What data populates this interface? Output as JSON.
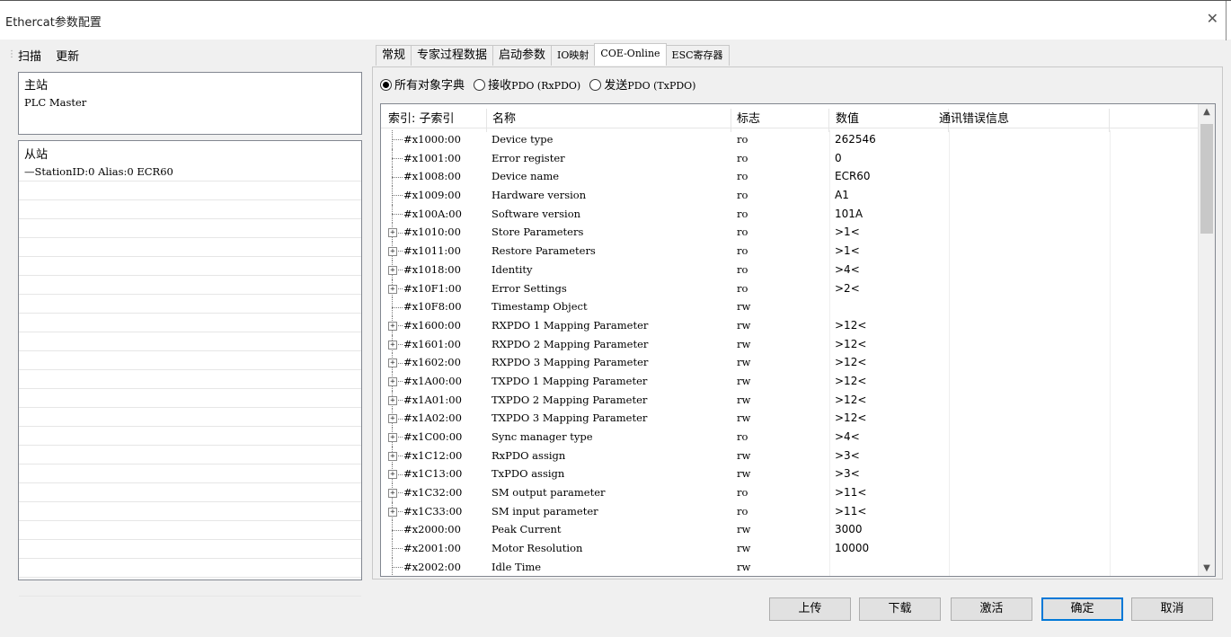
{
  "window": {
    "title": "Ethercat参数配置",
    "close_glyph": "✕"
  },
  "left_toolbar": {
    "scan": "扫描",
    "update": "更新"
  },
  "master_panel": {
    "header": "主站",
    "item": "PLC Master"
  },
  "slave_panel": {
    "header": "从站",
    "item": "StationID:0  Alias:0  ECR60"
  },
  "tabs": [
    "常规",
    "专家过程数据",
    "启动参数",
    "IO映射",
    "COE-Online",
    "ESC寄存器"
  ],
  "active_tab": "COE-Online",
  "radios": {
    "all": "所有对象字典",
    "rx_a": "接收",
    "rx_b": "PDO (RxPDO)",
    "tx_a": "发送",
    "tx_b": "PDO (TxPDO)",
    "selected": "all"
  },
  "columns": {
    "index": "索引: 子索引",
    "name": "名称",
    "flag": "标志",
    "value": "数值",
    "error": "通讯错误信息"
  },
  "rows": [
    {
      "index": "#x1000:00",
      "name": "Device type",
      "flag": "ro",
      "value": "262546",
      "expand": false
    },
    {
      "index": "#x1001:00",
      "name": "Error register",
      "flag": "ro",
      "value": "0",
      "expand": false
    },
    {
      "index": "#x1008:00",
      "name": "Device name",
      "flag": "ro",
      "value": "ECR60",
      "expand": false
    },
    {
      "index": "#x1009:00",
      "name": "Hardware version",
      "flag": "ro",
      "value": "A1",
      "expand": false
    },
    {
      "index": "#x100A:00",
      "name": "Software version",
      "flag": "ro",
      "value": "101A",
      "expand": false
    },
    {
      "index": "#x1010:00",
      "name": "Store Parameters",
      "flag": "ro",
      "value": ">1<",
      "expand": true
    },
    {
      "index": "#x1011:00",
      "name": "Restore Parameters",
      "flag": "ro",
      "value": ">1<",
      "expand": true
    },
    {
      "index": "#x1018:00",
      "name": "Identity",
      "flag": "ro",
      "value": ">4<",
      "expand": true
    },
    {
      "index": "#x10F1:00",
      "name": "Error Settings",
      "flag": "ro",
      "value": ">2<",
      "expand": true
    },
    {
      "index": "#x10F8:00",
      "name": "Timestamp Object",
      "flag": "rw",
      "value": "",
      "expand": false
    },
    {
      "index": "#x1600:00",
      "name": "RXPDO 1 Mapping Parameter",
      "flag": "rw",
      "value": ">12<",
      "expand": true
    },
    {
      "index": "#x1601:00",
      "name": "RXPDO 2 Mapping Parameter",
      "flag": "rw",
      "value": ">12<",
      "expand": true
    },
    {
      "index": "#x1602:00",
      "name": "RXPDO 3 Mapping Parameter",
      "flag": "rw",
      "value": ">12<",
      "expand": true
    },
    {
      "index": "#x1A00:00",
      "name": "TXPDO 1 Mapping Parameter",
      "flag": "rw",
      "value": ">12<",
      "expand": true
    },
    {
      "index": "#x1A01:00",
      "name": "TXPDO 2 Mapping Parameter",
      "flag": "rw",
      "value": ">12<",
      "expand": true
    },
    {
      "index": "#x1A02:00",
      "name": "TXPDO 3 Mapping Parameter",
      "flag": "rw",
      "value": ">12<",
      "expand": true
    },
    {
      "index": "#x1C00:00",
      "name": "Sync manager type",
      "flag": "ro",
      "value": ">4<",
      "expand": true
    },
    {
      "index": "#x1C12:00",
      "name": "RxPDO assign",
      "flag": "rw",
      "value": ">3<",
      "expand": true
    },
    {
      "index": "#x1C13:00",
      "name": "TxPDO assign",
      "flag": "rw",
      "value": ">3<",
      "expand": true
    },
    {
      "index": "#x1C32:00",
      "name": "SM output parameter",
      "flag": "ro",
      "value": ">11<",
      "expand": true
    },
    {
      "index": "#x1C33:00",
      "name": "SM input parameter",
      "flag": "ro",
      "value": ">11<",
      "expand": true
    },
    {
      "index": "#x2000:00",
      "name": "Peak Current",
      "flag": "rw",
      "value": "3000",
      "expand": false
    },
    {
      "index": "#x2001:00",
      "name": "Motor Resolution",
      "flag": "rw",
      "value": "10000",
      "expand": false
    },
    {
      "index": "#x2002:00",
      "name": "Idle Time",
      "flag": "rw",
      "value": "",
      "expand": false
    }
  ],
  "buttons": {
    "upload": "上传",
    "download": "下载",
    "activate": "激活",
    "ok": "确定",
    "cancel": "取消"
  }
}
